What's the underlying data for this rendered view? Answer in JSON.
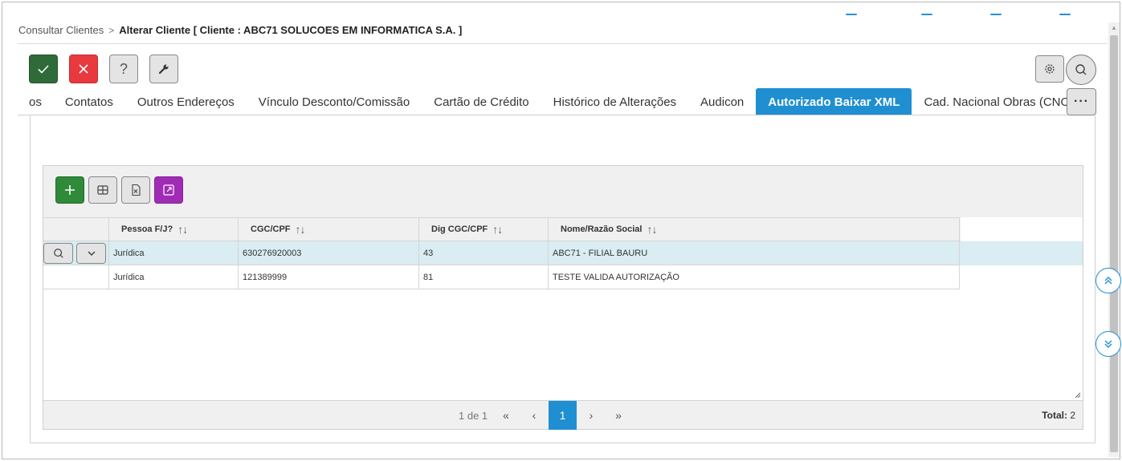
{
  "breadcrumb": {
    "parent": "Consultar Clientes",
    "separator": ">",
    "current": "Alterar Cliente [ Cliente : ABC71 SOLUCOES EM INFORMATICA S.A. ]"
  },
  "toolbar": {
    "confirm_icon": "check-icon",
    "cancel_icon": "close-icon",
    "help_label": "?",
    "tools_icon": "wrench-icon",
    "settings_icon": "gear-icon",
    "search_icon": "search-icon"
  },
  "tabs": [
    {
      "label": "os",
      "active": false
    },
    {
      "label": "Contatos",
      "active": false
    },
    {
      "label": "Outros Endereços",
      "active": false
    },
    {
      "label": "Vínculo Desconto/Comissão",
      "active": false
    },
    {
      "label": "Cartão de Crédito",
      "active": false
    },
    {
      "label": "Histórico de Alterações",
      "active": false
    },
    {
      "label": "Audicon",
      "active": false
    },
    {
      "label": "Autorizado Baixar XML",
      "active": true
    },
    {
      "label": "Cad. Nacional Obras (CNO)",
      "active": false
    }
  ],
  "more_label": "···",
  "grid": {
    "columns": [
      "Pessoa F/J?",
      "CGC/CPF",
      "Dig CGC/CPF",
      "Nome/Razão Social"
    ],
    "sort_glyph": "↑↓",
    "rows": [
      {
        "pessoa": "Jurídica",
        "cgc": "630276920003",
        "dig": "43",
        "nome": "ABC71 - FILIAL BAURU",
        "selected": true
      },
      {
        "pessoa": "Jurídica",
        "cgc": "121389999",
        "dig": "81",
        "nome": "TESTE VALIDA AUTORIZAÇÃO",
        "selected": false
      }
    ],
    "pager": {
      "info": "1 de 1",
      "first": "«",
      "prev": "‹",
      "current": "1",
      "next": "›",
      "last": "»"
    },
    "total_label": "Total:",
    "total_value": "2"
  },
  "colors": {
    "accent": "#1f8fd1",
    "confirm": "#2e6b38",
    "cancel": "#e8393f",
    "add": "#2f8a3a",
    "expand": "#a02cb5",
    "selected_row": "#d9edf2"
  }
}
